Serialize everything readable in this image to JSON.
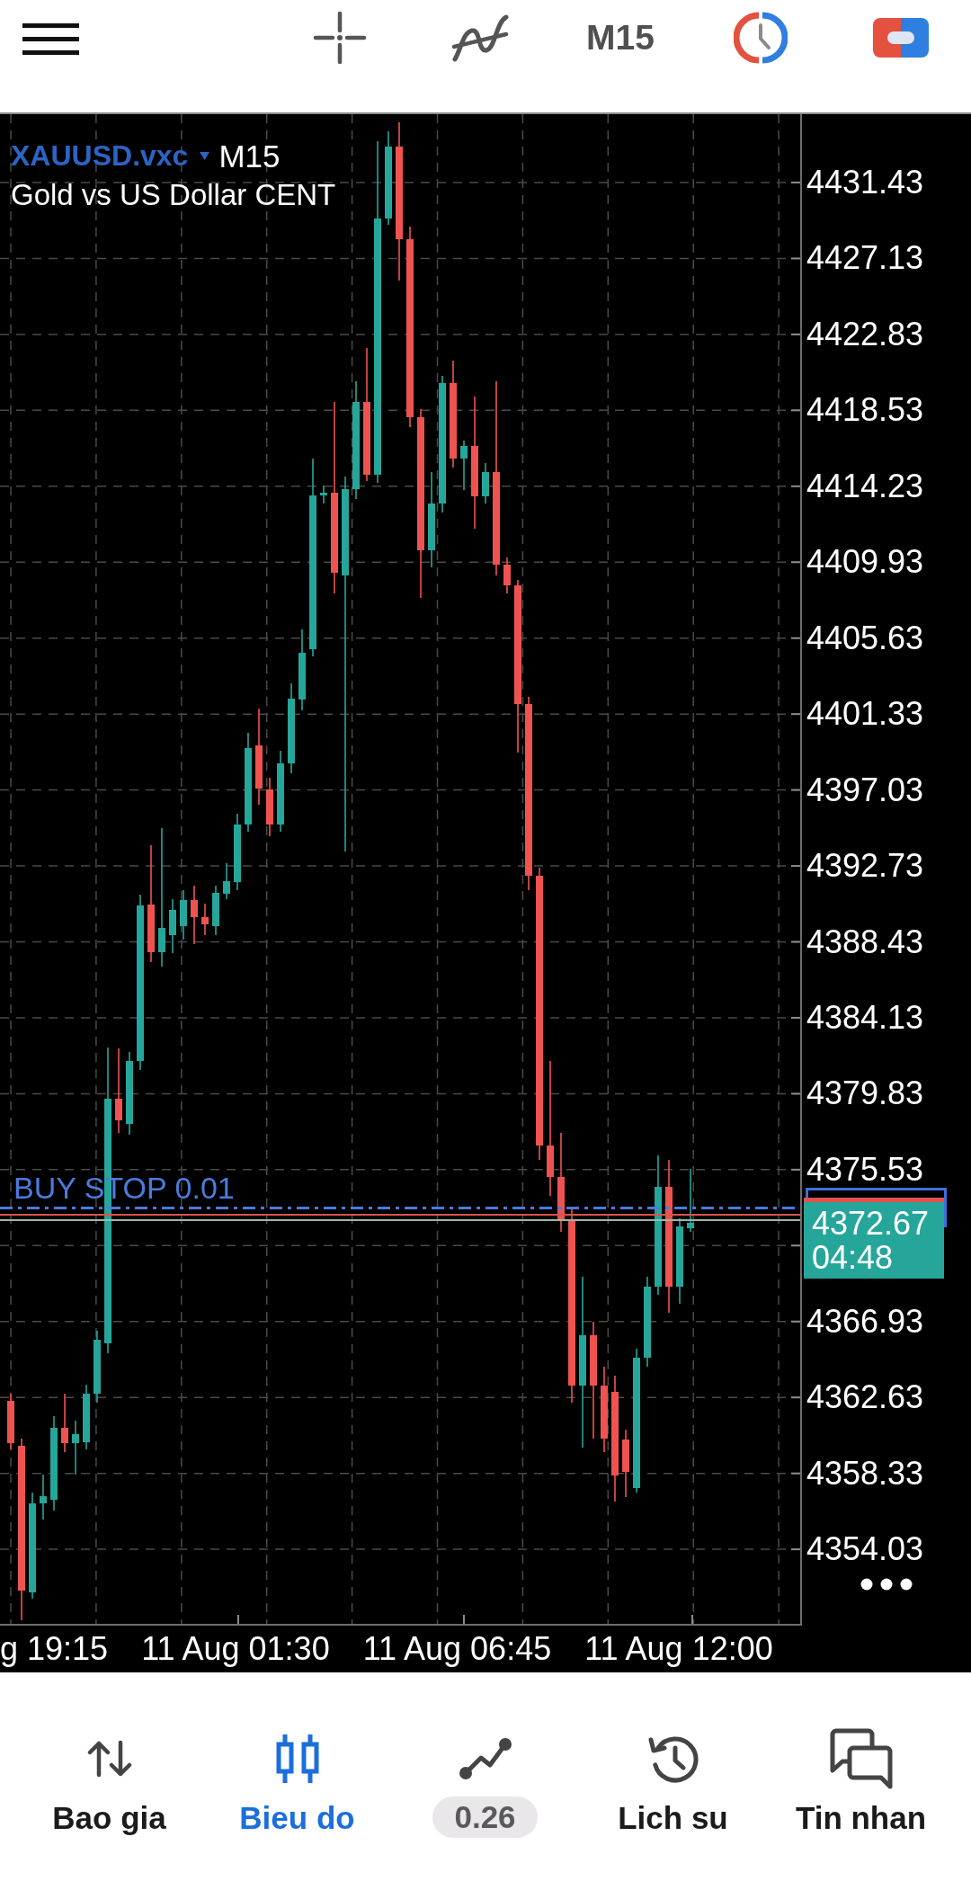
{
  "toolbar": {
    "timeframe": "M15"
  },
  "chart": {
    "symbol": "XAUUSD.vxc",
    "period": "M15",
    "description": "Gold vs US Dollar CENT",
    "order_label": "BUY STOP 0.01",
    "price_axis": [
      "4431.43",
      "4427.13",
      "4422.83",
      "4418.53",
      "4414.23",
      "4409.93",
      "4405.63",
      "4401.33",
      "4397.03",
      "4392.73",
      "4388.43",
      "4384.13",
      "4379.83",
      "4375.53",
      "4366.93",
      "4362.63",
      "4358.33",
      "4354.03"
    ],
    "current_price": {
      "price": "4372.67",
      "countdown": "04:48"
    },
    "time_axis": [
      "g 19:15",
      "11 Aug 01:30",
      "11 Aug 06:45",
      "11 Aug 12:00"
    ]
  },
  "nav": [
    {
      "kind": "tab",
      "label": "Bao gia",
      "selected": false
    },
    {
      "kind": "tab",
      "label": "Bieu do",
      "selected": true
    },
    {
      "kind": "badge",
      "label": "0.26",
      "selected": false
    },
    {
      "kind": "tab",
      "label": "Lich su",
      "selected": false
    },
    {
      "kind": "tab",
      "label": "Tin nhan",
      "selected": false
    }
  ]
}
